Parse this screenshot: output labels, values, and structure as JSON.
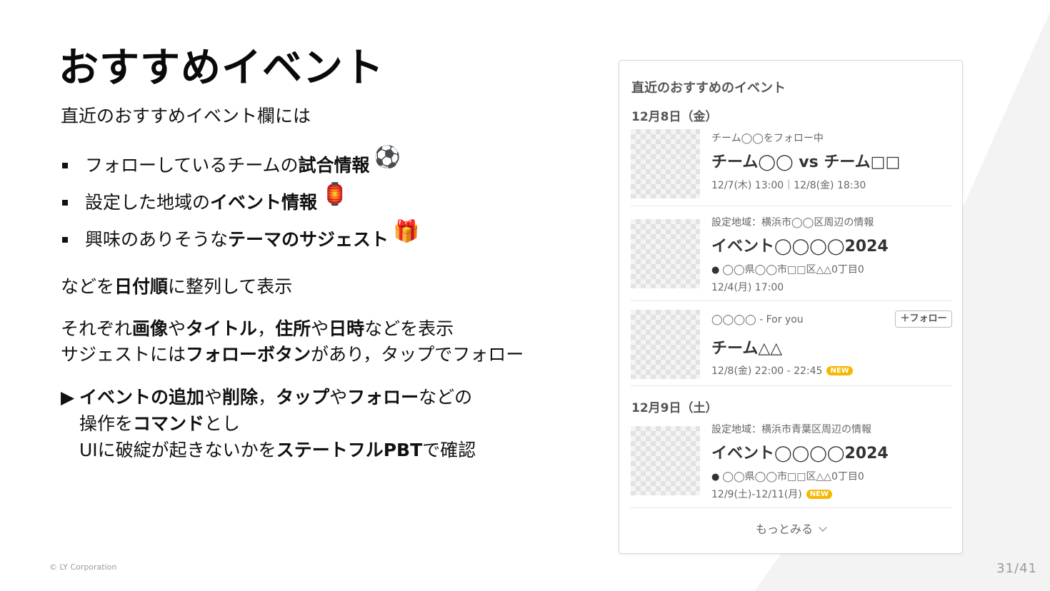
{
  "slide": {
    "title": "おすすめイベント",
    "intro": "直近のおすすめイベント欄には",
    "bullets": [
      {
        "pre": "フォローしているチームの",
        "bold": "試合情報",
        "post": "",
        "emoji": "⚽"
      },
      {
        "pre": "設定した地域の",
        "bold": "イベント情報",
        "post": "",
        "emoji": "🏮"
      },
      {
        "pre": "興味のありそうな",
        "bold": "テーマのサジェスト",
        "post": "",
        "emoji": "🎁"
      }
    ],
    "p1": {
      "a": "などを",
      "b": "日付順",
      "c": "に整列して表示"
    },
    "p2": {
      "l1": {
        "a": "それぞれ",
        "b": "画像",
        "c": "や",
        "d": "タイトル",
        "e": "，",
        "f": "住所",
        "g": "や",
        "h": "日時",
        "i": "などを表示"
      },
      "l2": {
        "a": "サジェストには",
        "b": "フォローボタン",
        "c": "があり，タップでフォロー"
      }
    },
    "p3": {
      "arrow": "▶",
      "l1": {
        "a": "イベントの追加",
        "b": "や",
        "c": "削除",
        "d": "，",
        "e": "タップ",
        "f": "や",
        "g": "フォロー",
        "h": "などの"
      },
      "l2": {
        "a": "操作を",
        "b": "コマンド",
        "c": "とし"
      },
      "l3": {
        "a": "UIに破綻が起きないかを",
        "b": "ステートフルPBT",
        "c": "で確認"
      }
    },
    "footer": "© LY Corporation",
    "page": "31/41"
  },
  "card": {
    "title": "直近のおすすめのイベント",
    "sections": [
      {
        "date": "12月8日（金）"
      },
      {
        "date": "12月9日（土）"
      }
    ],
    "items": [
      {
        "meta": "チーム◯◯をフォロー中",
        "title": "チーム◯◯ vs チーム□□",
        "schedule": "12/7(木) 13:00｜12/8(金) 18:30"
      },
      {
        "meta": "設定地域：横浜市◯◯区周辺の情報",
        "title": "イベント◯◯◯◯2024",
        "address": "◯◯県◯◯市□□区△△0丁目0",
        "schedule": "12/4(月)  17:00"
      },
      {
        "meta": "◯◯◯◯ - For you",
        "title": "チーム△△",
        "schedule": "12/8(金) 22:00 - 22:45",
        "badge": "NEW",
        "follow_label": "＋フォロー"
      },
      {
        "meta": "設定地域：横浜市青葉区周辺の情報",
        "title": "イベント◯◯◯◯2024",
        "address": "◯◯県◯◯市□□区△△0丁目0",
        "schedule": "12/9(土)-12/11(月)",
        "badge": "NEW"
      }
    ],
    "more_label": "もっとみる"
  }
}
